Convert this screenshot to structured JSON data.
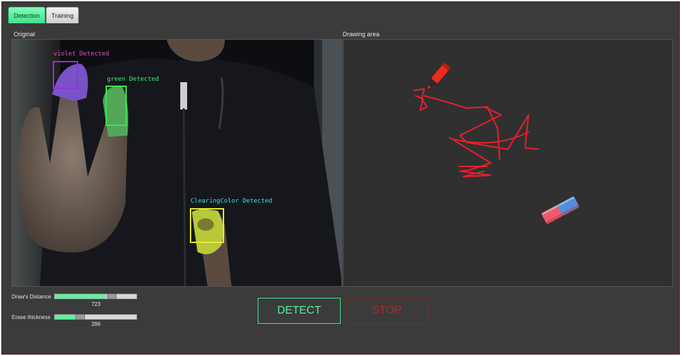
{
  "tabs": [
    {
      "label": "Detection",
      "active": true
    },
    {
      "label": "Training",
      "active": false
    }
  ],
  "panels": {
    "original_label": "Original",
    "drawing_label": "Drawing area"
  },
  "detections": [
    {
      "label": "violet Detected",
      "color": "#e84cb4",
      "box_color": "#9b2fd6"
    },
    {
      "label": "green Detected",
      "color": "#3cf07a",
      "box_color": "#38e84a"
    },
    {
      "label": "ClearingColor Detected",
      "color": "#3fe0ee",
      "box_color": "#e8e83a"
    }
  ],
  "sliders": [
    {
      "label": "Draw's Distance",
      "value": "723",
      "fraction": 0.62
    },
    {
      "label": "Erase thickness",
      "value": "286",
      "fraction": 0.25
    }
  ],
  "buttons": {
    "detect": "DETECT",
    "stop": "STOP"
  },
  "colors": {
    "accent_green": "#52f29e",
    "stop_red": "#b42828",
    "stroke_red": "#e8202a"
  },
  "icons": [
    "marker-icon",
    "eraser-icon"
  ]
}
